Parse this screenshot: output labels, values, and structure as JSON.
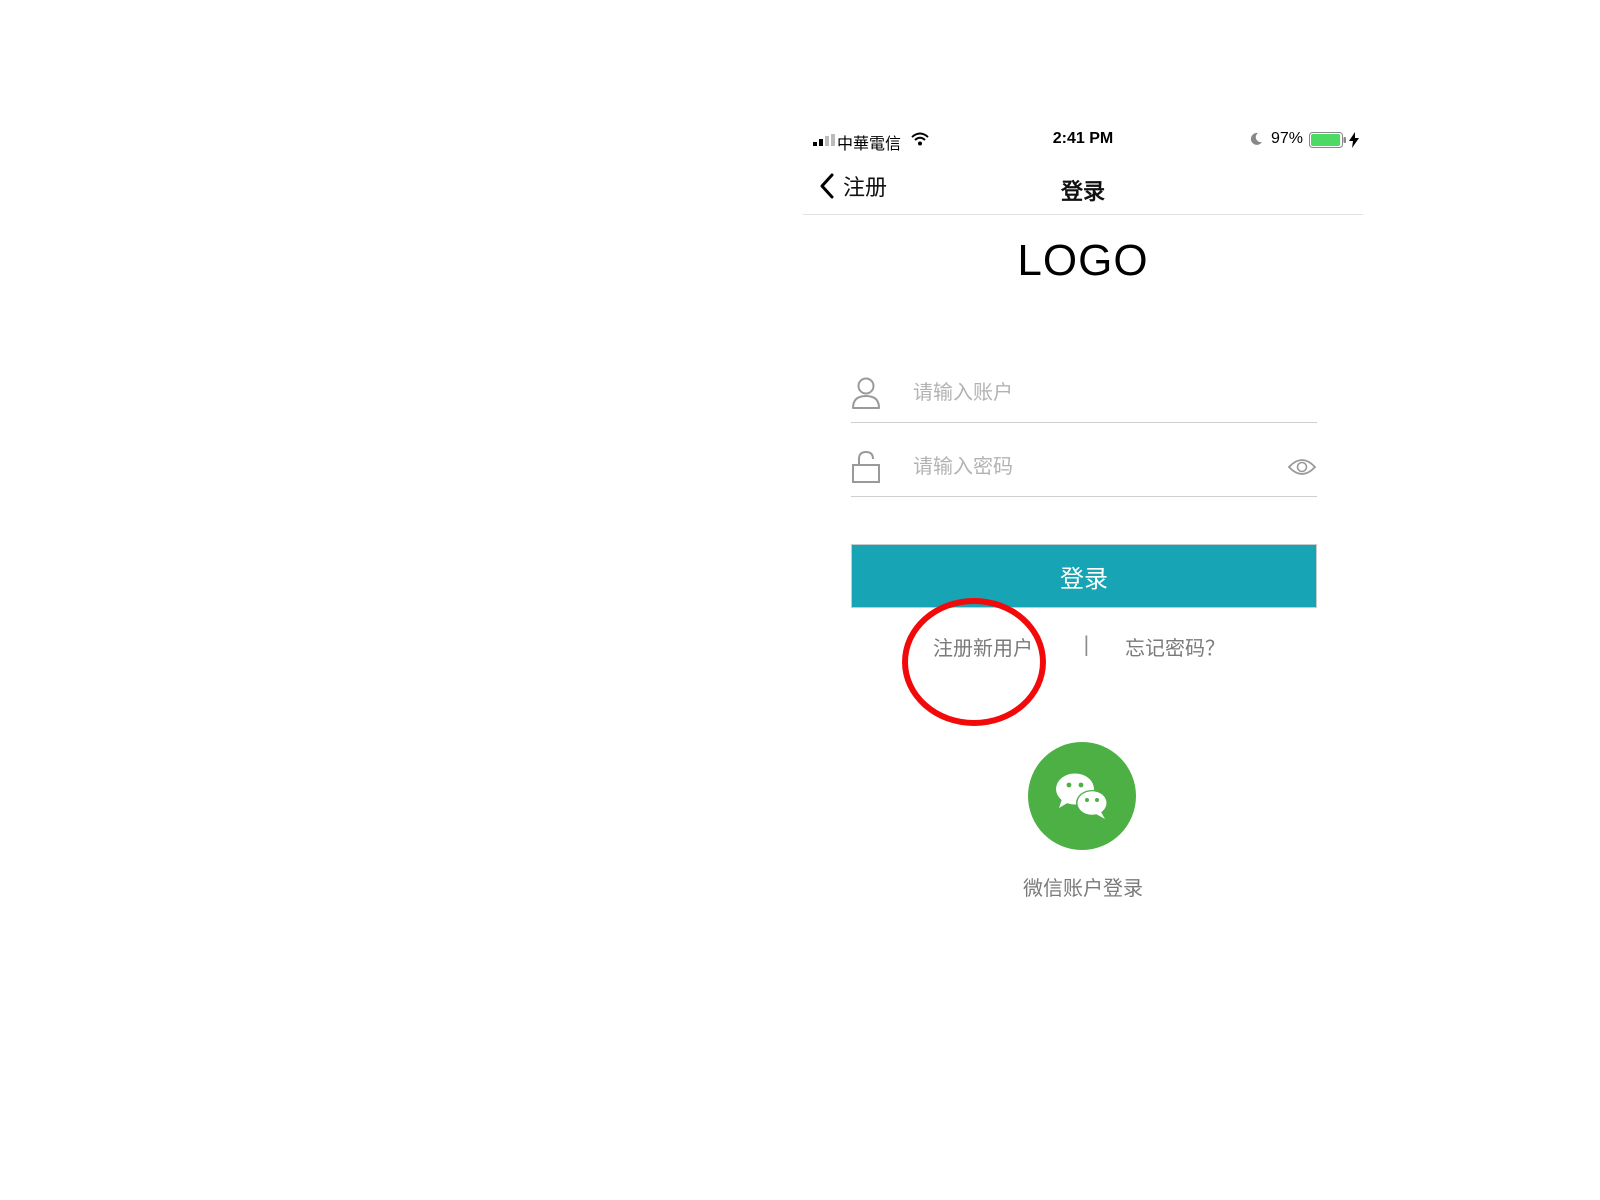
{
  "status_bar": {
    "carrier": "中華電信",
    "time": "2:41 PM",
    "battery": "97%",
    "battery_level": 0.97,
    "icons": [
      "signal-icon",
      "wifi-icon",
      "moon-icon",
      "battery-icon",
      "charging-bolt-icon"
    ]
  },
  "nav": {
    "back_label": "注册",
    "title": "登录"
  },
  "logo": "LOGO",
  "form": {
    "account_placeholder": "请输入账户",
    "password_placeholder": "请输入密码",
    "login_label": "登录",
    "register_label": "注册新用户",
    "divider": "|",
    "forgot_label": "忘记密码？"
  },
  "wechat": {
    "label": "微信账户登录"
  },
  "colors": {
    "login_button": "#17a4b5",
    "wechat_green": "#4cb045",
    "battery_green": "#4cd964",
    "annotation_red": "#f20a0a"
  }
}
